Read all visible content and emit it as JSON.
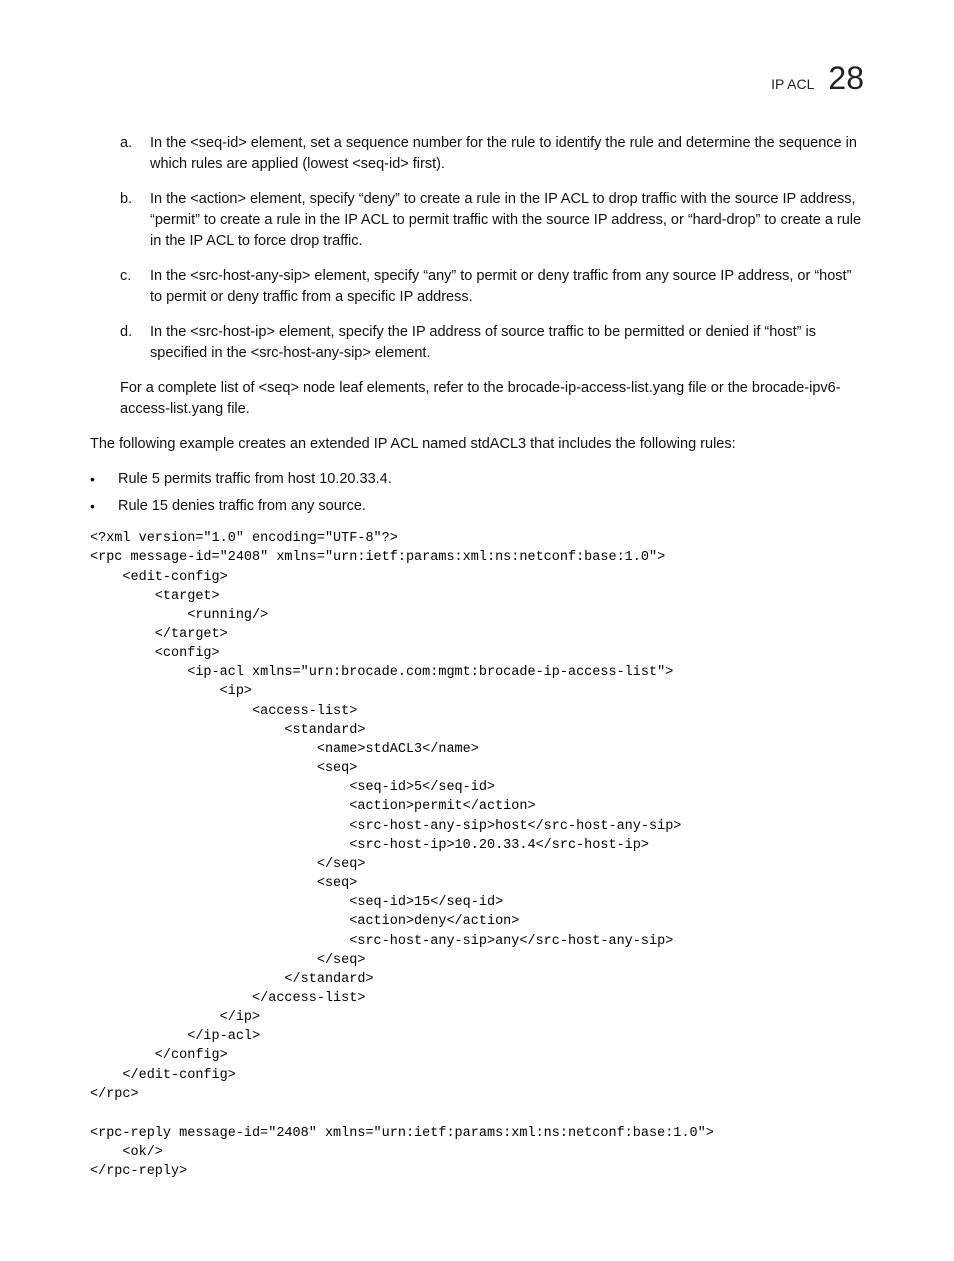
{
  "header": {
    "section": "IP ACL",
    "chapter": "28"
  },
  "steps": [
    {
      "marker": "a.",
      "text": "In the <seq-id> element, set a sequence number for the rule to identify the rule and determine the sequence in which rules are applied (lowest <seq-id> first)."
    },
    {
      "marker": "b.",
      "text": "In the <action> element, specify “deny” to create a rule in the IP ACL to drop traffic with the source IP address, “permit” to create a rule in the IP ACL to permit traffic with the source IP address, or “hard-drop” to create a rule in the IP ACL to force drop traffic."
    },
    {
      "marker": "c.",
      "text": "In the <src-host-any-sip> element, specify “any” to permit or deny traffic from any source IP address, or “host” to permit or deny traffic from a specific IP address."
    },
    {
      "marker": "d.",
      "text": "In the <src-host-ip> element, specify the IP address of source traffic to be permitted or denied if “host” is specified in the <src-host-any-sip> element."
    }
  ],
  "note": "For a complete list of <seq> node leaf elements, refer to the brocade-ip-access-list.yang file or the brocade-ipv6-access-list.yang file.",
  "intro": "The following example creates an extended IP ACL named stdACL3 that includes the following rules:",
  "rules": [
    "Rule 5 permits traffic from host 10.20.33.4.",
    "Rule 15 denies traffic from any source."
  ],
  "code1": "<?xml version=\"1.0\" encoding=\"UTF-8\"?>\n<rpc message-id=\"2408\" xmlns=\"urn:ietf:params:xml:ns:netconf:base:1.0\">\n    <edit-config>\n        <target>\n            <running/>\n        </target>\n        <config>\n            <ip-acl xmlns=\"urn:brocade.com:mgmt:brocade-ip-access-list\">\n                <ip>\n                    <access-list>\n                        <standard>\n                            <name>stdACL3</name>\n                            <seq>\n                                <seq-id>5</seq-id>\n                                <action>permit</action>\n                                <src-host-any-sip>host</src-host-any-sip>\n                                <src-host-ip>10.20.33.4</src-host-ip>\n                            </seq>\n                            <seq>\n                                <seq-id>15</seq-id>\n                                <action>deny</action>\n                                <src-host-any-sip>any</src-host-any-sip>\n                            </seq>\n                        </standard>\n                    </access-list>\n                </ip>\n            </ip-acl>\n        </config>\n    </edit-config>\n</rpc>",
  "code2": "<rpc-reply message-id=\"2408\" xmlns=\"urn:ietf:params:xml:ns:netconf:base:1.0\">\n    <ok/>\n</rpc-reply>"
}
